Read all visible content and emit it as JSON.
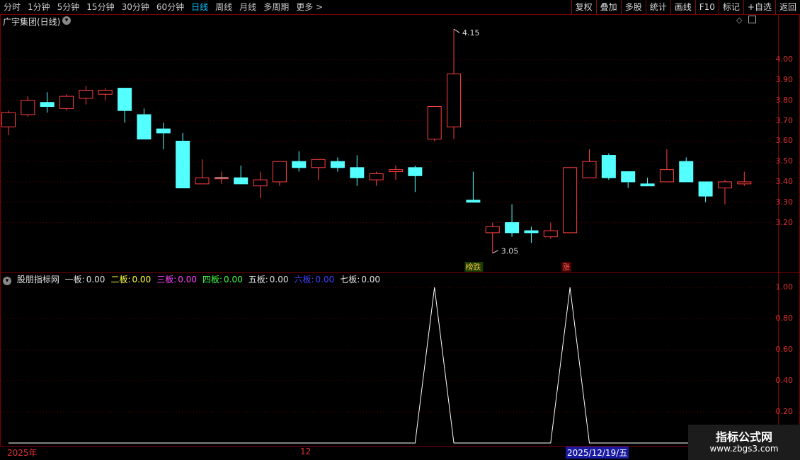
{
  "toolbar": {
    "periods": [
      "分时",
      "1分钟",
      "5分钟",
      "15分钟",
      "30分钟",
      "60分钟",
      "日线",
      "周线",
      "月线",
      "多周期",
      "更多 >"
    ],
    "active_period": "日线",
    "right_buttons": [
      "复权",
      "叠加",
      "多股",
      "统计",
      "画线",
      "F10",
      "标记",
      "+自选",
      "返回"
    ]
  },
  "main_chart": {
    "title": "广宇集团(日线)",
    "price_labels": [
      "4.00",
      "3.90",
      "3.80",
      "3.70",
      "3.60",
      "3.50",
      "3.40",
      "3.30",
      "3.20"
    ],
    "high_marker": "4.15",
    "low_marker": "3.05",
    "tags": [
      "榜跌",
      "涨"
    ]
  },
  "indicator": {
    "name": "股朋指标网",
    "items": [
      {
        "label": "一板:",
        "value": "0.00",
        "color": "#e0e0e0"
      },
      {
        "label": "二板:",
        "value": "0.00",
        "color": "#ffff40"
      },
      {
        "label": "三板:",
        "value": "0.00",
        "color": "#ff40ff"
      },
      {
        "label": "四板:",
        "value": "0.00",
        "color": "#40ff40"
      },
      {
        "label": "五板:",
        "value": "0.00",
        "color": "#e0e0e0"
      },
      {
        "label": "六板:",
        "value": "0.00",
        "color": "#4040ff"
      },
      {
        "label": "七板:",
        "value": "0.00",
        "color": "#e0e0e0"
      }
    ],
    "axis_labels": [
      "1.00",
      "0.80",
      "0.60",
      "0.40",
      "0.20"
    ]
  },
  "date_axis": {
    "left": "2025年",
    "mid": "12",
    "cursor": "2025/12/19/五"
  },
  "watermark": {
    "line1": "指标公式网",
    "line2": "www.zbgs3.com"
  },
  "colors": {
    "up": "#ff4040",
    "down": "#54ffff",
    "grid": "#5a0000",
    "axis_text": "#e03030"
  },
  "chart_data": {
    "type": "candlestick",
    "candles": [
      {
        "o": 3.67,
        "c": 3.74,
        "h": 3.75,
        "l": 3.63
      },
      {
        "o": 3.73,
        "c": 3.8,
        "h": 3.82,
        "l": 3.72
      },
      {
        "o": 3.79,
        "c": 3.77,
        "h": 3.84,
        "l": 3.74
      },
      {
        "o": 3.76,
        "c": 3.82,
        "h": 3.83,
        "l": 3.75
      },
      {
        "o": 3.81,
        "c": 3.85,
        "h": 3.87,
        "l": 3.78
      },
      {
        "o": 3.83,
        "c": 3.85,
        "h": 3.86,
        "l": 3.8
      },
      {
        "o": 3.86,
        "c": 3.75,
        "h": 3.86,
        "l": 3.69
      },
      {
        "o": 3.73,
        "c": 3.61,
        "h": 3.76,
        "l": 3.61
      },
      {
        "o": 3.66,
        "c": 3.64,
        "h": 3.69,
        "l": 3.56
      },
      {
        "o": 3.6,
        "c": 3.37,
        "h": 3.64,
        "l": 3.37
      },
      {
        "o": 3.39,
        "c": 3.42,
        "h": 3.51,
        "l": 3.39
      },
      {
        "o": 3.42,
        "c": 3.42,
        "h": 3.45,
        "l": 3.39
      },
      {
        "o": 3.42,
        "c": 3.39,
        "h": 3.48,
        "l": 3.39
      },
      {
        "o": 3.38,
        "c": 3.41,
        "h": 3.45,
        "l": 3.32
      },
      {
        "o": 3.4,
        "c": 3.5,
        "h": 3.5,
        "l": 3.38
      },
      {
        "o": 3.5,
        "c": 3.47,
        "h": 3.55,
        "l": 3.45
      },
      {
        "o": 3.47,
        "c": 3.51,
        "h": 3.51,
        "l": 3.41
      },
      {
        "o": 3.5,
        "c": 3.47,
        "h": 3.52,
        "l": 3.45
      },
      {
        "o": 3.47,
        "c": 3.42,
        "h": 3.53,
        "l": 3.38
      },
      {
        "o": 3.41,
        "c": 3.44,
        "h": 3.45,
        "l": 3.38
      },
      {
        "o": 3.45,
        "c": 3.46,
        "h": 3.48,
        "l": 3.41
      },
      {
        "o": 3.47,
        "c": 3.43,
        "h": 3.48,
        "l": 3.35
      },
      {
        "o": 3.61,
        "c": 3.77,
        "h": 3.77,
        "l": 3.6
      },
      {
        "o": 3.67,
        "c": 3.93,
        "h": 4.15,
        "l": 3.61
      },
      {
        "o": 3.31,
        "c": 3.3,
        "h": 3.45,
        "l": 3.3
      },
      {
        "o": 3.15,
        "c": 3.18,
        "h": 3.2,
        "l": 3.05
      },
      {
        "o": 3.2,
        "c": 3.15,
        "h": 3.29,
        "l": 3.13
      },
      {
        "o": 3.16,
        "c": 3.15,
        "h": 3.18,
        "l": 3.1
      },
      {
        "o": 3.13,
        "c": 3.16,
        "h": 3.2,
        "l": 3.12
      },
      {
        "o": 3.15,
        "c": 3.47,
        "h": 3.47,
        "l": 3.15
      },
      {
        "o": 3.42,
        "c": 3.5,
        "h": 3.56,
        "l": 3.42
      },
      {
        "o": 3.53,
        "c": 3.42,
        "h": 3.54,
        "l": 3.41
      },
      {
        "o": 3.45,
        "c": 3.4,
        "h": 3.45,
        "l": 3.37
      },
      {
        "o": 3.39,
        "c": 3.38,
        "h": 3.42,
        "l": 3.38
      },
      {
        "o": 3.4,
        "c": 3.46,
        "h": 3.56,
        "l": 3.4
      },
      {
        "o": 3.5,
        "c": 3.4,
        "h": 3.52,
        "l": 3.4
      },
      {
        "o": 3.4,
        "c": 3.33,
        "h": 3.4,
        "l": 3.3
      },
      {
        "o": 3.37,
        "c": 3.4,
        "h": 3.41,
        "l": 3.29
      },
      {
        "o": 3.39,
        "c": 3.4,
        "h": 3.45,
        "l": 3.38
      }
    ],
    "ylim": [
      3.05,
      4.15
    ],
    "indicator_series": {
      "name": "一板",
      "peaks_at_candle": [
        22,
        29
      ],
      "ylim": [
        0,
        1
      ]
    }
  }
}
